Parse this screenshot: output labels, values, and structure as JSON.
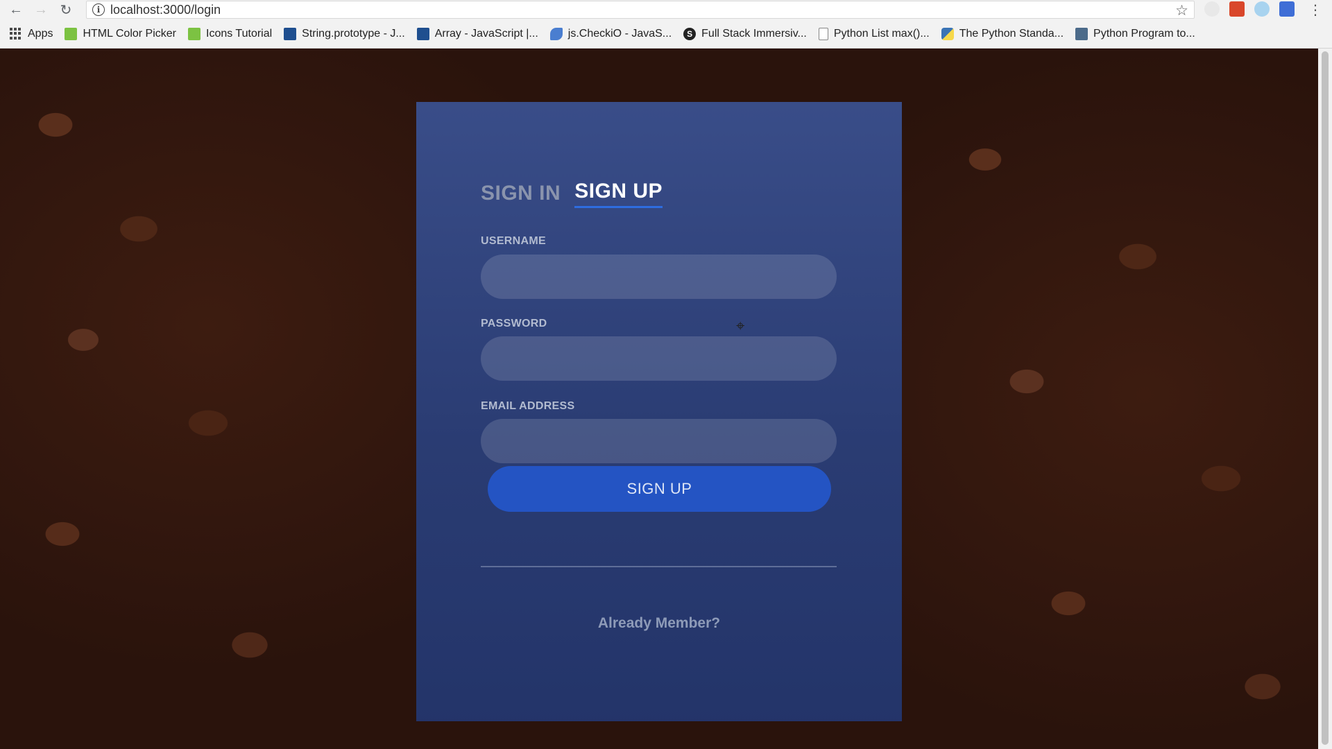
{
  "browser": {
    "url": "localhost:3000/login",
    "bookmarks": [
      {
        "label": "Apps",
        "icon": "apps-grid-icon"
      },
      {
        "label": "HTML Color Picker",
        "icon": "w3-icon"
      },
      {
        "label": "Icons Tutorial",
        "icon": "w3-icon"
      },
      {
        "label": "String.prototype - J...",
        "icon": "mdn-icon"
      },
      {
        "label": "Array - JavaScript |...",
        "icon": "mdn-icon"
      },
      {
        "label": "js.CheckiO - JavaS...",
        "icon": "checkio-icon"
      },
      {
        "label": "Full Stack Immersiv...",
        "icon": "s-icon"
      },
      {
        "label": "Python List max()...",
        "icon": "document-icon"
      },
      {
        "label": "The Python Standa...",
        "icon": "python-icon"
      },
      {
        "label": "Python Program to...",
        "icon": "programiz-icon"
      }
    ]
  },
  "form": {
    "tab_signin": "SIGN IN",
    "tab_signup": "SIGN UP",
    "username_label": "USERNAME",
    "password_label": "PASSWORD",
    "email_label": "EMAIL ADDRESS",
    "username_value": "",
    "password_value": "",
    "email_value": "",
    "submit_label": "SIGN UP",
    "footer_link": "Already Member?"
  },
  "colors": {
    "card": "#2b4078",
    "button": "#2454c3",
    "active_tab_underline": "#2e6de0"
  }
}
